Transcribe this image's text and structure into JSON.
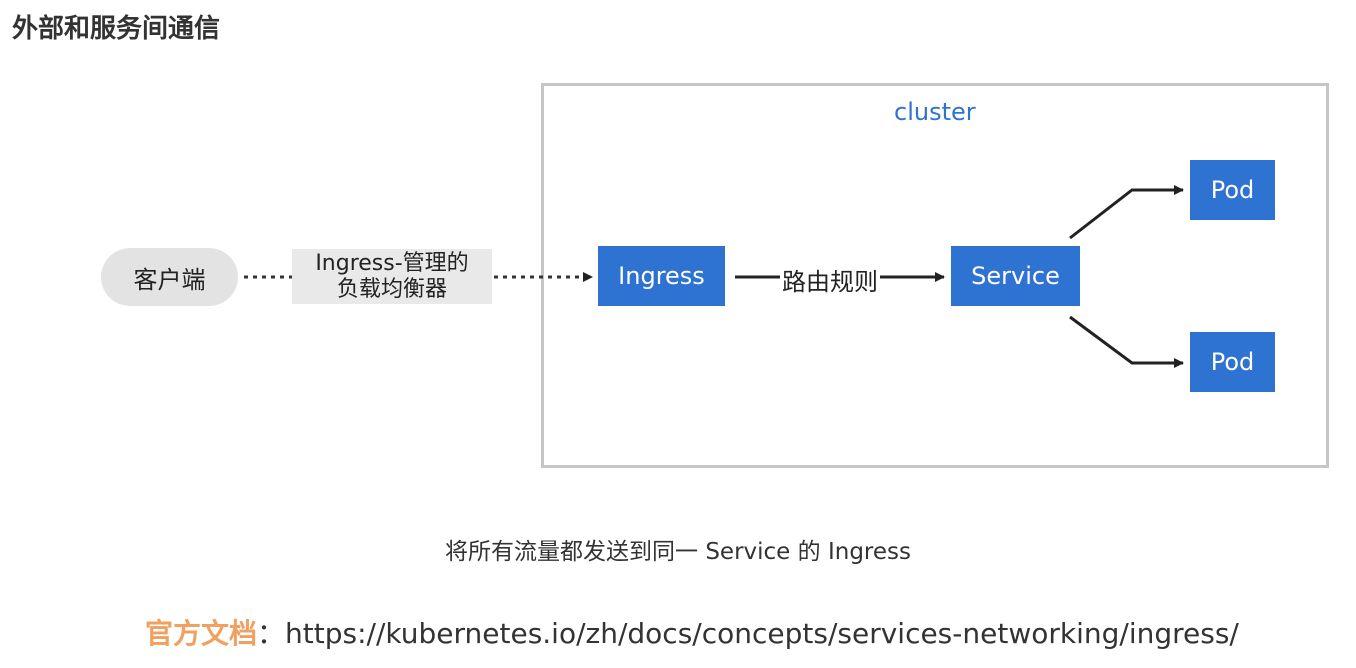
{
  "title": "外部和服务间通信",
  "diagram": {
    "cluster_label": "cluster",
    "client": "客户端",
    "lb_label_line1": "Ingress-管理的",
    "lb_label_line2": "负载均衡器",
    "ingress": "Ingress",
    "route_label": "路由规则",
    "service": "Service",
    "pod1": "Pod",
    "pod2": "Pod"
  },
  "caption": "将所有流量都发送到同一 Service 的 Ingress",
  "doc": {
    "label": "官方文档",
    "separator": "：",
    "url": "https://kubernetes.io/zh/docs/concepts/services-networking/ingress/"
  },
  "colors": {
    "node_blue": "#2e72d2",
    "cluster_border": "#c6c6c6",
    "client_bg": "#e3e3e3",
    "doc_label": "#f0a060"
  }
}
